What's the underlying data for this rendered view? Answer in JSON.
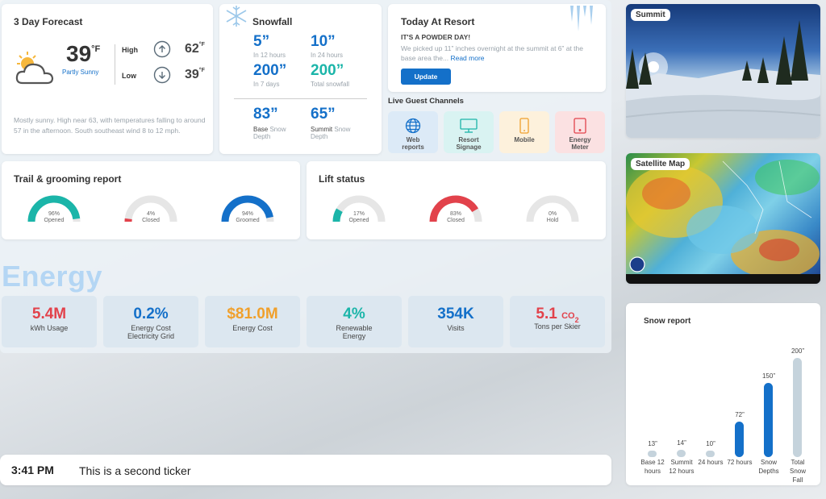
{
  "forecast": {
    "title": "3 Day Forecast",
    "temp": "39",
    "unit": "°F",
    "condition": "Partly Sunny",
    "high_label": "High",
    "high_value": "62",
    "low_label": "Low",
    "low_value": "39",
    "description": "Mostly sunny. High near 63, with temperatures falling to around 57 in the afternoon. South southeast wind 8 to 12 mph."
  },
  "snowfall": {
    "title": "Snowfall",
    "items": [
      {
        "value": "5”",
        "label": "In 12 hours"
      },
      {
        "value": "10”",
        "label": "In 24 hours"
      },
      {
        "value": "200”",
        "label": "In 7 days"
      },
      {
        "value": "200”",
        "label": "Total snowfall"
      },
      {
        "value": "83”",
        "label_bold": "Base",
        "label_rest": "Snow",
        "label2": "Depth"
      },
      {
        "value": "65”",
        "label_bold": "Summit",
        "label_rest": "Snow",
        "label2": "Depth"
      }
    ]
  },
  "resort": {
    "title": "Today At Resort",
    "headline": "IT'S A POWDER DAY!",
    "body": "We picked up 11” inches overnight at the summit at 6” at the base area the...",
    "read_more": "Read more",
    "button": "Update",
    "channels_title": "Live Guest Channels",
    "channels": [
      {
        "l1": "Web",
        "l2": "reports",
        "bg": "#dceaf7",
        "color": "#1470c9",
        "icon": "globe-icon"
      },
      {
        "l1": "Resort",
        "l2": "Signage",
        "bg": "#d9f3f2",
        "color": "#1bb5a9",
        "icon": "monitor-icon"
      },
      {
        "l1": "Mobile",
        "l2": "",
        "bg": "#fdf1dc",
        "color": "#f0a02c",
        "icon": "phone-icon"
      },
      {
        "l1": "Energy",
        "l2": "Meter",
        "bg": "#fbe1e2",
        "color": "#e2424b",
        "icon": "tablet-icon"
      }
    ]
  },
  "trail": {
    "title": "Trail & grooming report",
    "gauges": [
      {
        "pct": "96%",
        "label": "Opened",
        "value": 0.96,
        "color": "#1bb5a9"
      },
      {
        "pct": "4%",
        "label": "Closed",
        "value": 0.04,
        "color": "#e2424b"
      },
      {
        "pct": "94%",
        "label": "Groomed",
        "value": 0.94,
        "color": "#1470c9"
      }
    ]
  },
  "lift": {
    "title": "Lift status",
    "gauges": [
      {
        "pct": "17%",
        "label": "Opened",
        "value": 0.17,
        "color": "#1bb5a9"
      },
      {
        "pct": "83%",
        "label": "Closed",
        "value": 0.83,
        "color": "#e2424b"
      },
      {
        "pct": "0%",
        "label": "Hold",
        "value": 0.0,
        "color": "#999999"
      }
    ]
  },
  "energy": {
    "title": "Energy",
    "cards": [
      {
        "value": "5.4M",
        "label": "kWh Usage",
        "color": "#e2424b"
      },
      {
        "value": "0.2%",
        "label": "Energy Cost Electricity Grid",
        "color": "#1470c9"
      },
      {
        "value": "$81.0M",
        "label": "Energy Cost",
        "color": "#f0a02c"
      },
      {
        "value": "4%",
        "label": "Renewable Energy",
        "color": "#1bb5a9"
      },
      {
        "value": "354K",
        "label": "Visits",
        "color": "#1470c9"
      },
      {
        "value": "5.1",
        "value_suffix": "CO",
        "value_sub": "2",
        "label": "Tons per Skier",
        "color": "#e2424b"
      }
    ]
  },
  "ticker": {
    "time": "3:41 PM",
    "text": "This is a second ticker"
  },
  "summit": {
    "label": "Summit"
  },
  "satellite": {
    "label": "Satellite Map"
  },
  "snow_report": {
    "title": "Snow report",
    "chart_data": {
      "type": "bar",
      "categories": [
        "Base 12 hours",
        "Summit 12 hours",
        "24 hours",
        "72 hours",
        "Snow Depths",
        "Total Snow Fall"
      ],
      "values": [
        13,
        14,
        10,
        72,
        150,
        200
      ],
      "value_labels": [
        "13”",
        "14”",
        "10”",
        "72”",
        "150”",
        "200”"
      ],
      "colors": [
        "#c5d3dc",
        "#c5d3dc",
        "#c5d3dc",
        "#1470c9",
        "#1470c9",
        "#c5d3dc"
      ],
      "ylim": [
        0,
        200
      ]
    }
  }
}
